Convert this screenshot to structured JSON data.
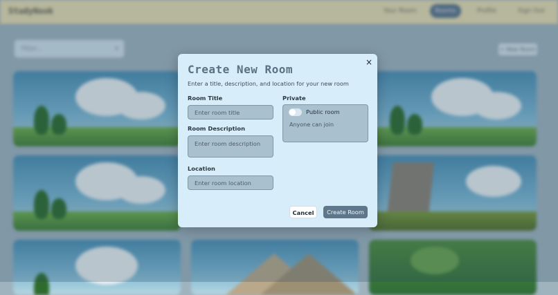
{
  "nav": {
    "logo": "StudyNook",
    "links": [
      "Your Room",
      "Rooms",
      "Profile",
      "Sign Out"
    ]
  },
  "toolbar": {
    "filter_placeholder": "Filter...",
    "new_room_label": "+ New Room"
  },
  "modal": {
    "title": "Create New Room",
    "subtitle": "Enter a title, description, and location for your new room",
    "close_label": "×",
    "room_title_label": "Room Title",
    "room_title_placeholder": "Enter room title",
    "room_title_value": "",
    "room_description_label": "Room Description",
    "room_description_placeholder": "Enter room description",
    "room_description_value": "",
    "location_label": "Location",
    "location_placeholder": "Enter room location",
    "location_value": "",
    "private_label": "Private",
    "public_toggle_label": "Public room",
    "public_toggle_on": false,
    "public_hint": "Anyone can join",
    "cancel_label": "Cancel",
    "create_label": "Create Room"
  },
  "colors": {
    "modal_bg": "#d7eefa",
    "title_color": "#5a7183",
    "input_bg": "#a9c0cf",
    "create_button_bg": "#5e778a",
    "navbar_bg": "#e6dcb1"
  }
}
